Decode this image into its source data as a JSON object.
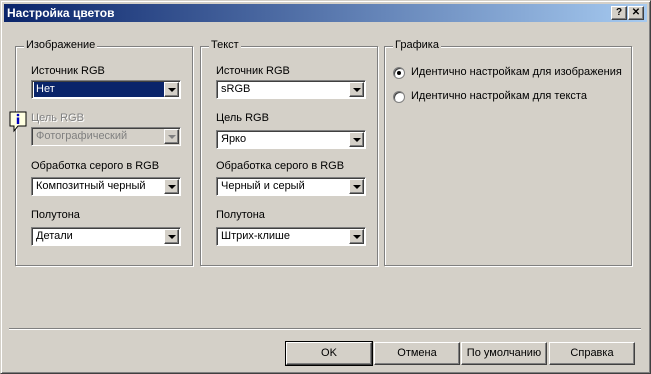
{
  "window": {
    "title": "Настройка цветов",
    "help_btn": "?",
    "close_btn": "✕"
  },
  "groups": {
    "image": {
      "title": "Изображение",
      "source_label": "Источник RGB",
      "source_value": "Нет",
      "target_label": "Цель RGB",
      "target_value": "Фотографический",
      "gray_label": "Обработка серого в RGB",
      "gray_value": "Композитный черный",
      "halftone_label": "Полутона",
      "halftone_value": "Детали"
    },
    "text": {
      "title": "Текст",
      "source_label": "Источник RGB",
      "source_value": "sRGB",
      "target_label": "Цель RGB",
      "target_value": "Ярко",
      "gray_label": "Обработка серого в RGB",
      "gray_value": "Черный и серый",
      "halftone_label": "Полутона",
      "halftone_value": "Штрих-клише"
    },
    "graphics": {
      "title": "Графика",
      "options": [
        "Идентично настройкам для изображения",
        "Идентично настройкам для текста"
      ],
      "selected": 0
    }
  },
  "buttons": {
    "ok": "OK",
    "cancel": "Отмена",
    "default": "По умолчанию",
    "help": "Справка"
  },
  "icons": {
    "info": "info-icon",
    "dropdown": "chevron-down-icon"
  },
  "colors": {
    "face": "#d4d0c8",
    "title_start": "#0a246a",
    "title_end": "#a6caf0",
    "selection": "#0a246a"
  }
}
